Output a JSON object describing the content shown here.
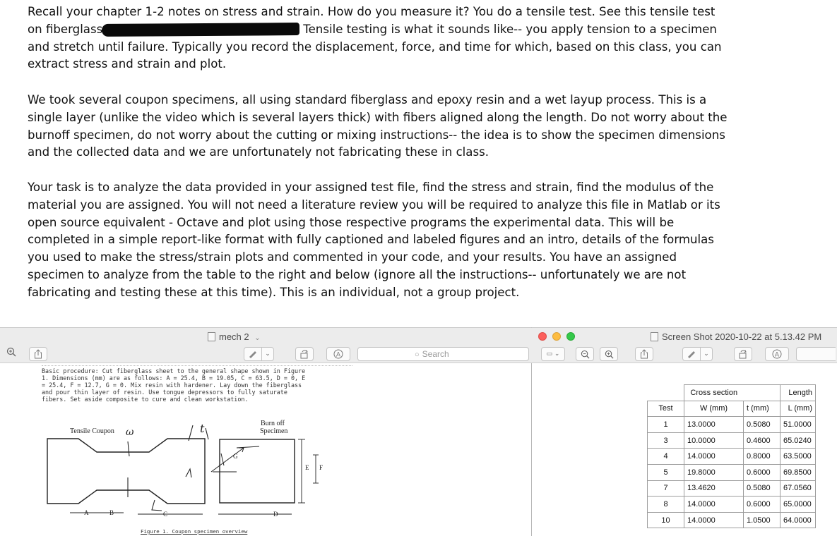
{
  "document": {
    "p1a": "Recall your chapter 1-2 notes on stress and strain.  How do you measure it?  You do a tensile test.  See this tensile test",
    "p1b_start": "on fiberglass",
    "p1b_end": "Tensile testing is what it sounds like-- you apply tension to a specimen",
    "p1c": "and stretch until failure.  Typically you record the displacement, force, and time for which, based on this class, you can",
    "p1d": "extract stress and strain and plot.",
    "p2": "We took several coupon specimens, all using standard fiberglass and epoxy resin and a wet layup process.  This is a single layer (unlike the video which is several layers thick) with fibers aligned along the length.  Do not worry about the burnoff specimen, do not worry about the cutting or mixing instructions-- the idea is to show the specimen dimensions and the collected data and we are unfortunately not fabricating these in class.",
    "p3": "Your task is to analyze the data provided in your assigned test file, find the stress and strain, find the modulus of the material you are assigned.  You will not need a literature review you will be required to analyze this file in Matlab or its open source equivalent - Octave and plot using those respective programs the experimental data.  This will be completed in a simple report-like format with fully captioned and labeled figures and an intro, details of the formulas you used to make the stress/strain plots and commented in your code, and your results.  You have an assigned specimen to analyze from the table to the right and below (ignore all the instructions-- unfortunately we are not fabricating and testing these at this time).  This is an individual, not a group project."
  },
  "left_window": {
    "title": "mech 2",
    "title_chevron": "⌄",
    "search_placeholder": "Search",
    "pdf": {
      "procedure_lines": [
        "Basic procedure: Cut fiberglass sheet to the general shape shown in Figure",
        "1.  Dimensions (mm) are as follows: A = 25.4, B = 19.05, C = 63.5, D = 0, E",
        "= 25.4, F = 12.7, G = 0.  Mix resin with hardener.  Lay down the fiberglass",
        "and pour thin layer of resin.  Use tongue depressors to fully saturate",
        "fibers.  Set aside composite to cure and clean workstation."
      ],
      "tensile_label": "Tensile Coupon",
      "burnoff_label": "Burn off",
      "specimen_label": "Specimen",
      "dims": {
        "A": "A",
        "B": "B",
        "C": "C",
        "D": "D",
        "E": "E",
        "F": "F",
        "G": "G"
      },
      "handwriting": {
        "w": "ω",
        "t": "t",
        "L": "L"
      },
      "caption": "Figure 1.   Coupon specimen overview"
    }
  },
  "right_window": {
    "title": "Screen Shot 2020-10-22 at 5.13.42 PM",
    "table": {
      "header_top": [
        "",
        "Cross section",
        "",
        "Length"
      ],
      "header": [
        "Test",
        "W (mm)",
        "t (mm)",
        "L (mm)"
      ],
      "rows": [
        [
          "1",
          "13.0000",
          "0.5080",
          "51.0000"
        ],
        [
          "3",
          "10.0000",
          "0.4600",
          "65.0240"
        ],
        [
          "4",
          "14.0000",
          "0.8000",
          "63.5000"
        ],
        [
          "5",
          "19.8000",
          "0.6000",
          "69.8500"
        ],
        [
          "7",
          "13.4620",
          "0.5080",
          "67.0560"
        ],
        [
          "8",
          "14.0000",
          "0.6000",
          "65.0000"
        ],
        [
          "10",
          "14.0000",
          "1.0500",
          "64.0000"
        ]
      ]
    }
  },
  "colors": {
    "window_bar": "#ececec",
    "close": "#fc605c",
    "minimize": "#fdbc40",
    "zoom": "#34c84a"
  }
}
